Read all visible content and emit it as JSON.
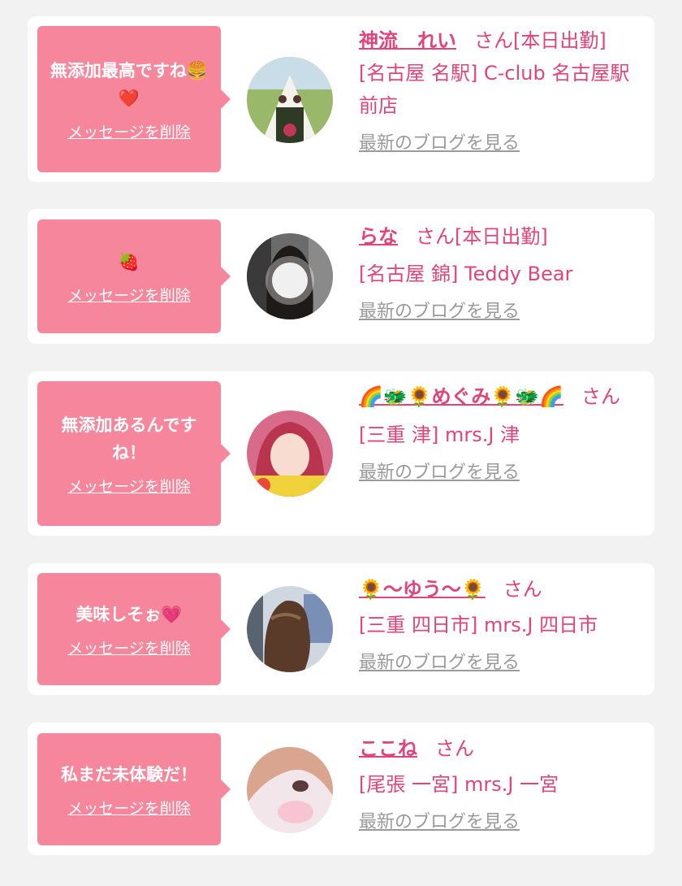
{
  "delete_label": "メッセージを削除",
  "blog_label": "最新のブログを見る",
  "san_label": "さん",
  "colors": {
    "accent": "#e0447a",
    "bubble": "#f6869b",
    "background": "#f2f2f2",
    "link_gray": "#9a9a9a"
  },
  "cards": [
    {
      "message": "無添加最高ですね🍔❤️",
      "girl_name": "神流　れい",
      "status": "[本日出勤]",
      "shop": "[名古屋 名駅] C-club 名古屋駅前店"
    },
    {
      "message": "🍓",
      "girl_name": "らな",
      "status": "[本日出勤]",
      "shop": "[名古屋 錦] Teddy Bear"
    },
    {
      "message": "無添加あるんですね！",
      "girl_name": "🌈🐲🌻めぐみ🌻🐲🌈",
      "status": "",
      "shop": "[三重 津] mrs.J 津"
    },
    {
      "message": "美味しそぉ💗",
      "girl_name": "🌻〜ゆう〜🌻",
      "status": "",
      "shop": "[三重 四日市] mrs.J 四日市"
    },
    {
      "message": "私まだ未体験だ！",
      "girl_name": "ここね",
      "status": "",
      "shop": "[尾張 一宮] mrs.J 一宮"
    }
  ]
}
